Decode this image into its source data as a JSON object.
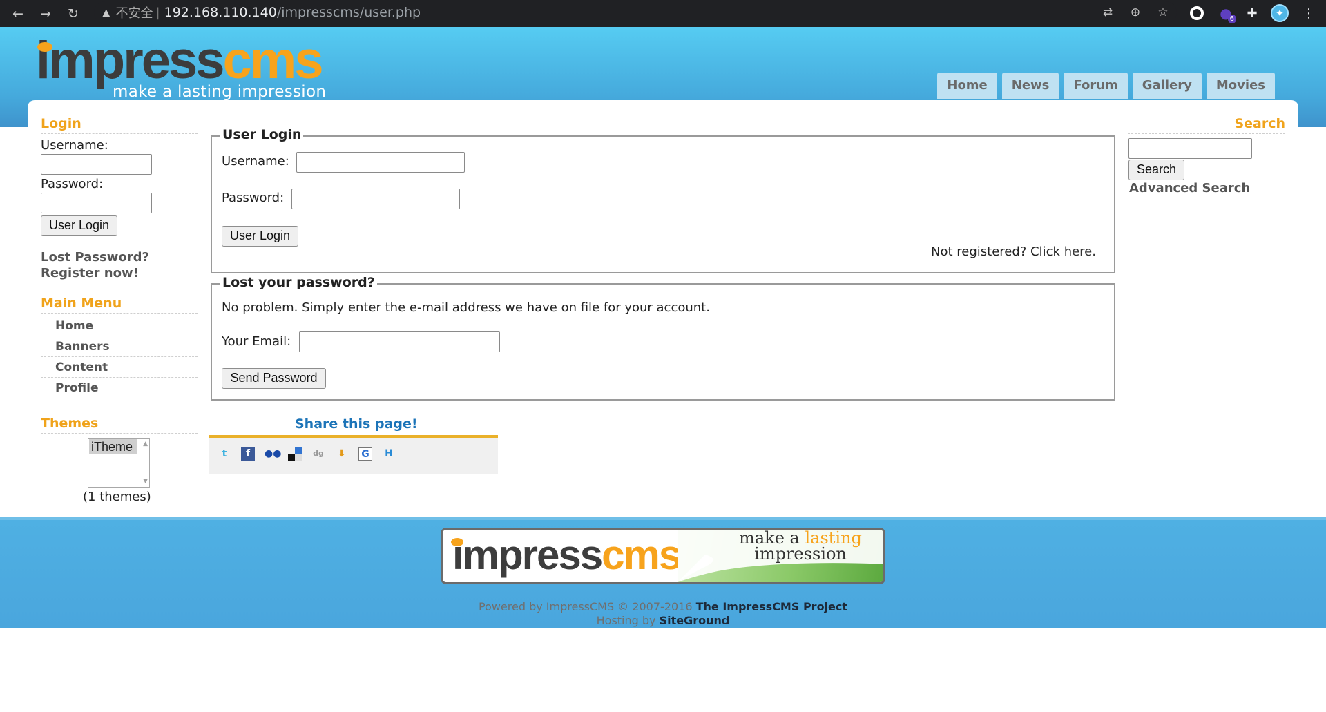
{
  "browser": {
    "warning_label": "不安全",
    "separator": "|",
    "url_host": "192.168.110.140",
    "url_path": "/impresscms/user.php",
    "extension_badge": "6"
  },
  "header": {
    "logo_part1": "impress",
    "logo_part2": "cms",
    "logo_tagline": "make a lasting impression",
    "tabs": [
      {
        "label": "Home"
      },
      {
        "label": "News"
      },
      {
        "label": "Forum"
      },
      {
        "label": "Gallery"
      },
      {
        "label": "Movies"
      }
    ]
  },
  "login_block": {
    "title": "Login",
    "username_label": "Username:",
    "password_label": "Password:",
    "button_label": "User Login",
    "lost_password": "Lost Password?",
    "register": "Register now!"
  },
  "main_menu": {
    "title": "Main Menu",
    "items": [
      {
        "label": "Home"
      },
      {
        "label": "Banners"
      },
      {
        "label": "Content"
      },
      {
        "label": "Profile"
      }
    ]
  },
  "themes_block": {
    "title": "Themes",
    "selected": "iTheme",
    "count_text": "(1 themes)"
  },
  "user_login_form": {
    "legend": "User Login",
    "username_label": "Username:",
    "password_label": "Password:",
    "button_label": "User Login",
    "not_registered": "Not registered? Click",
    "here_link": "here."
  },
  "lost_password_form": {
    "legend": "Lost your password?",
    "description": "No problem. Simply enter the e-mail address we have on file for your account.",
    "email_label": "Your Email:",
    "button_label": "Send Password"
  },
  "share": {
    "title": "Share this page!",
    "icons": [
      "twitter-icon",
      "facebook-icon",
      "myspace-icon",
      "delicious-icon",
      "digg-icon",
      "stumble-icon",
      "google-icon",
      "hyves-icon"
    ]
  },
  "search_block": {
    "title": "Search",
    "button_label": "Search",
    "advanced_link": "Advanced Search"
  },
  "footer": {
    "logo_part1": "impress",
    "logo_part2": "cms",
    "slogan_a": "make a ",
    "slogan_hl": "lasting",
    "slogan_b": "impression",
    "powered_prefix": "Powered by ImpressCMS © 2007-2016 ",
    "powered_link": "The ImpressCMS Project",
    "hosting_prefix": "Hosting by ",
    "hosting_link": "SiteGround"
  },
  "colors": {
    "accent_orange": "#f0a31b",
    "header_blue": "#45a9dc",
    "link_blue": "#1c74b8"
  }
}
